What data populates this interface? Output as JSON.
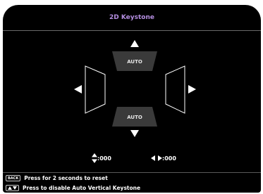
{
  "header": {
    "title": "2D Keystone"
  },
  "keystone": {
    "top_auto_label": "AUTO",
    "bottom_auto_label": "AUTO",
    "vertical_value": ":000",
    "horizontal_value": ":000"
  },
  "footer": {
    "back_key": "BACK",
    "back_hint": "Press for 2 seconds to reset",
    "updown_hint": "Press to disable Auto Vertical Keystone"
  },
  "colors": {
    "title": "#b48ee0",
    "background": "#000000",
    "panel": "#3a3a3a",
    "outline": "#ffffff"
  }
}
